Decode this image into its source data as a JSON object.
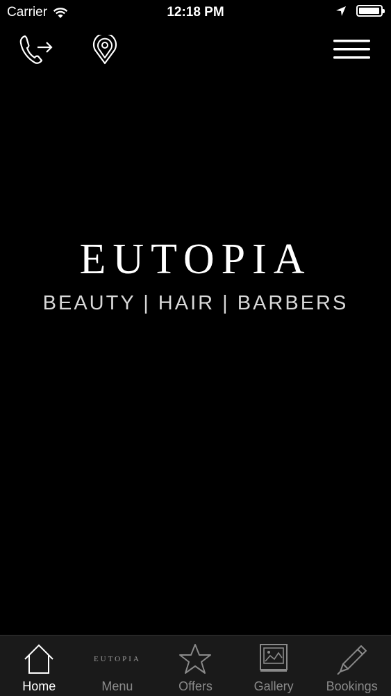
{
  "status_bar": {
    "carrier": "Carrier",
    "time": "12:18 PM",
    "battery_level": 0.95
  },
  "top_bar": {
    "call_icon": "phone-forward-icon",
    "location_icon": "map-pin-icon",
    "menu_icon": "hamburger-menu-icon"
  },
  "brand": {
    "title": "EUTOPIA",
    "tagline": "BEAUTY | HAIR | BARBERS"
  },
  "tabs": [
    {
      "label": "Home",
      "icon": "house-icon",
      "active": true
    },
    {
      "label": "Menu",
      "icon": "eutopia-logo",
      "logo_text": "EUTOPIA",
      "active": false
    },
    {
      "label": "Offers",
      "icon": "star-icon",
      "active": false
    },
    {
      "label": "Gallery",
      "icon": "image-icon",
      "active": false
    },
    {
      "label": "Bookings",
      "icon": "pencil-icon",
      "active": false
    }
  ],
  "colors": {
    "background": "#000000",
    "tab_bar": "#1a1a1a",
    "tab_inactive": "#8a8a8a",
    "tab_active": "#ffffff"
  }
}
